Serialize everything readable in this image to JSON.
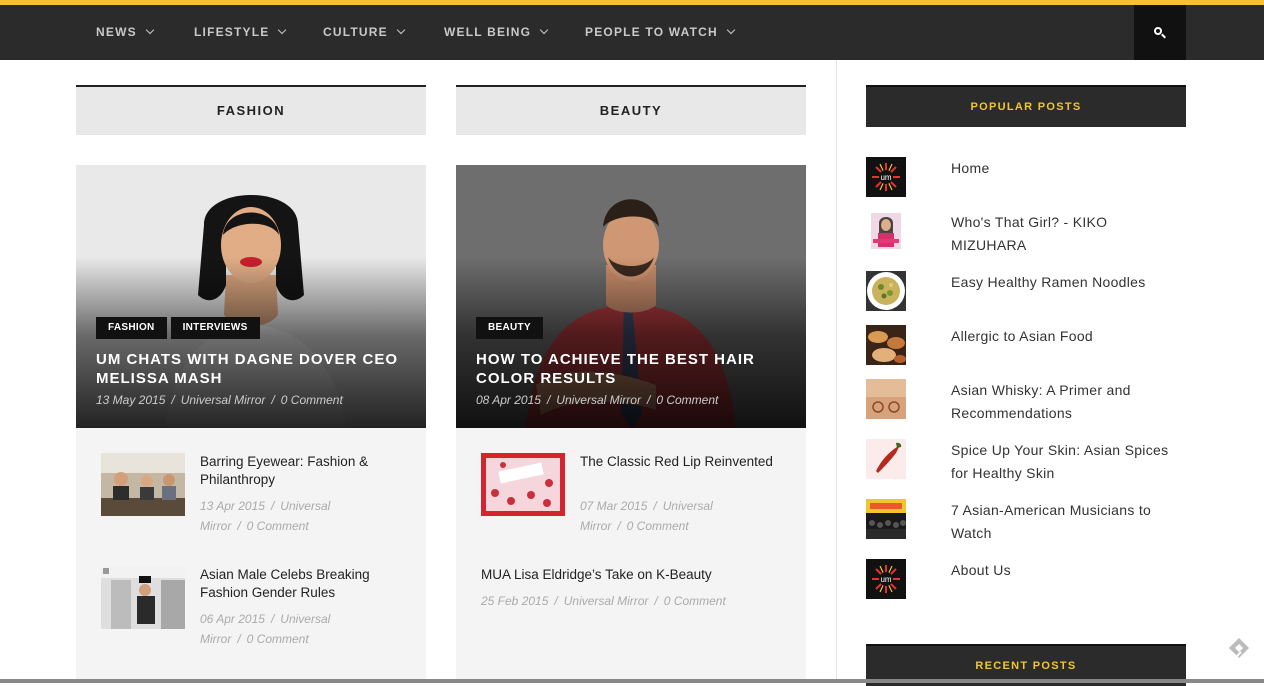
{
  "nav": {
    "items": [
      {
        "label": "NEWS"
      },
      {
        "label": "LIFESTYLE"
      },
      {
        "label": "CULTURE"
      },
      {
        "label": "WELL BEING"
      },
      {
        "label": "PEOPLE TO WATCH"
      }
    ],
    "search_icon": "search-icon"
  },
  "columns": [
    {
      "heading": "FASHION",
      "feature": {
        "tags": [
          "FASHION",
          "INTERVIEWS"
        ],
        "title": "UM CHATS WITH DAGNE DOVER CEO MELISSA MASH",
        "date": "13 May 2015",
        "author": "Universal Mirror",
        "comments": "0 Comment"
      },
      "posts": [
        {
          "title": "Barring Eyewear: Fashion & Philanthropy",
          "date": "13 Apr 2015",
          "author": "Universal Mirror",
          "comments": "0 Comment"
        },
        {
          "title": "Asian Male Celebs Breaking Fashion Gender Rules",
          "date": "06 Apr 2015",
          "author": "Universal Mirror",
          "comments": "0 Comment"
        }
      ]
    },
    {
      "heading": "BEAUTY",
      "feature": {
        "tags": [
          "BEAUTY"
        ],
        "title": "HOW TO ACHIEVE THE BEST HAIR COLOR RESULTS",
        "date": "08 Apr 2015",
        "author": "Universal Mirror",
        "comments": "0 Comment"
      },
      "posts": [
        {
          "title": "The Classic Red Lip Reinvented",
          "date": "07 Mar 2015",
          "author": "Universal Mirror",
          "comments": "0 Comment"
        },
        {
          "title": "MUA Lisa Eldridge’s Take on K-Beauty",
          "date": "25 Feb 2015",
          "author": "Universal Mirror",
          "comments": "0 Comment"
        }
      ]
    }
  ],
  "sidebar": {
    "popular_heading": "POPULAR POSTS",
    "popular": [
      {
        "label": "Home"
      },
      {
        "label": "Who's That Girl? - KIKO MIZUHARA"
      },
      {
        "label": "Easy Healthy Ramen Noodles"
      },
      {
        "label": "Allergic to Asian Food"
      },
      {
        "label": "Asian Whisky: A Primer and Recommendations"
      },
      {
        "label": "Spice Up Your Skin: Asian Spices for Healthy Skin"
      },
      {
        "label": "7 Asian-American Musicians to Watch"
      },
      {
        "label": "About Us"
      }
    ],
    "recent_heading": "RECENT POSTS"
  },
  "colors": {
    "accent": "#f2c530",
    "nav_bg": "#2b2b2b",
    "header_bg": "#e8e8e8"
  }
}
